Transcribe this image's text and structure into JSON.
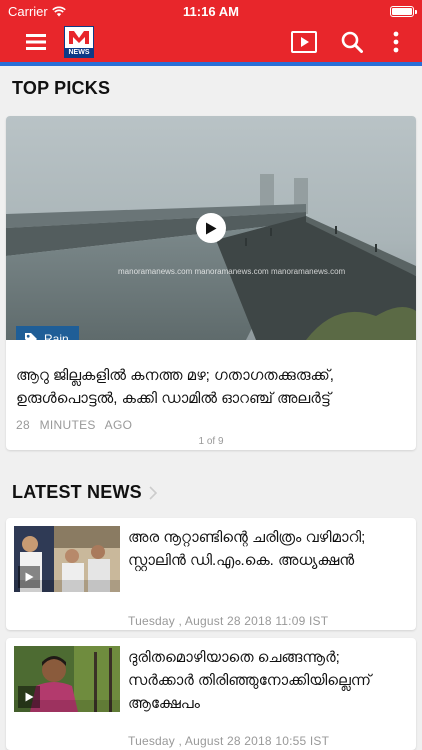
{
  "status_bar": {
    "carrier": "Carrier",
    "time": "11:16 AM"
  },
  "nav": {
    "logo_text": "NEWS",
    "icons": [
      "menu-icon",
      "play-video-icon",
      "search-icon",
      "more-vertical-icon"
    ],
    "colors": {
      "bar": "#e8262b",
      "stripe": "#2a6fd6"
    }
  },
  "top_picks": {
    "title": "TOP PICKS",
    "watermark": "manoramanews.com  manoramanews.com  manoramanews.com",
    "tag": "Rain",
    "headline": "ആറു ജില്ലകളിൽ കനത്ത മഴ; ഗതാഗതക്കുരുക്ക്, ഉരുൾപൊട്ടൽ, കക്കി ഡാമിൽ ഓറഞ്ച് അലർട്ട്",
    "time": "28 MINUTES AGO",
    "pager": "1 of 9"
  },
  "latest_news": {
    "title": "LATEST NEWS",
    "items": [
      {
        "headline": "അര നൂറ്റാണ്ടിന്റെ ചരിത്രം വഴിമാറി; സ്റ്റാലിൻ ഡി.എം.കെ. അധ്യക്ഷൻ",
        "date": "Tuesday , August 28 2018 11:09 IST"
      },
      {
        "headline": "ദുരിതമൊഴിയാതെ ചെങ്ങന്നൂർ; സർക്കാർ തിരിഞ്ഞുനോക്കിയില്ലെന്ന് ആക്ഷേപം",
        "date": "Tuesday , August 28 2018 10:55 IST"
      }
    ]
  }
}
